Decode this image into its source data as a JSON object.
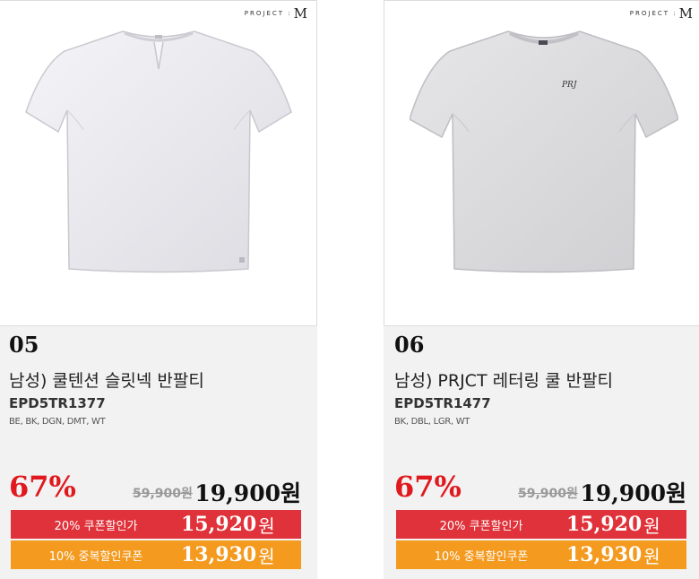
{
  "brand": {
    "logo_text": "PROJECT :",
    "logo_mark": "M"
  },
  "products": [
    {
      "number": "05",
      "title": "남성) 쿨텐션 슬릿넥 반팔티",
      "code": "EPD5TR1377",
      "colors": "BE, BK, DGN, DMT, WT",
      "discount": "67%",
      "original_price": "59,900원",
      "price": "19,900원",
      "coupon1_label": "20% 쿠폰할인가",
      "coupon1_amount": "15,920",
      "coupon2_label": "10% 중복할인쿠폰",
      "coupon2_amount": "13,930",
      "currency": "원",
      "shirt_color": "#eeeef2",
      "image_icon": "white-slit-neck-tshirt"
    },
    {
      "number": "06",
      "title": "남성) PRJCT 레터링 쿨 반팔티",
      "code": "EPD5TR1477",
      "colors": "BK, DBL, LGR, WT",
      "discount": "67%",
      "original_price": "59,900원",
      "price": "19,900원",
      "coupon1_label": "20% 쿠폰할인가",
      "coupon1_amount": "15,920",
      "coupon2_label": "10% 중복할인쿠폰",
      "coupon2_amount": "13,930",
      "currency": "원",
      "shirt_color": "#dcdcde",
      "image_icon": "gray-crew-neck-tshirt"
    }
  ],
  "colors": {
    "discount_red": "#e0191e",
    "coupon_red": "#e0323a",
    "coupon_orange": "#f39a1f"
  }
}
